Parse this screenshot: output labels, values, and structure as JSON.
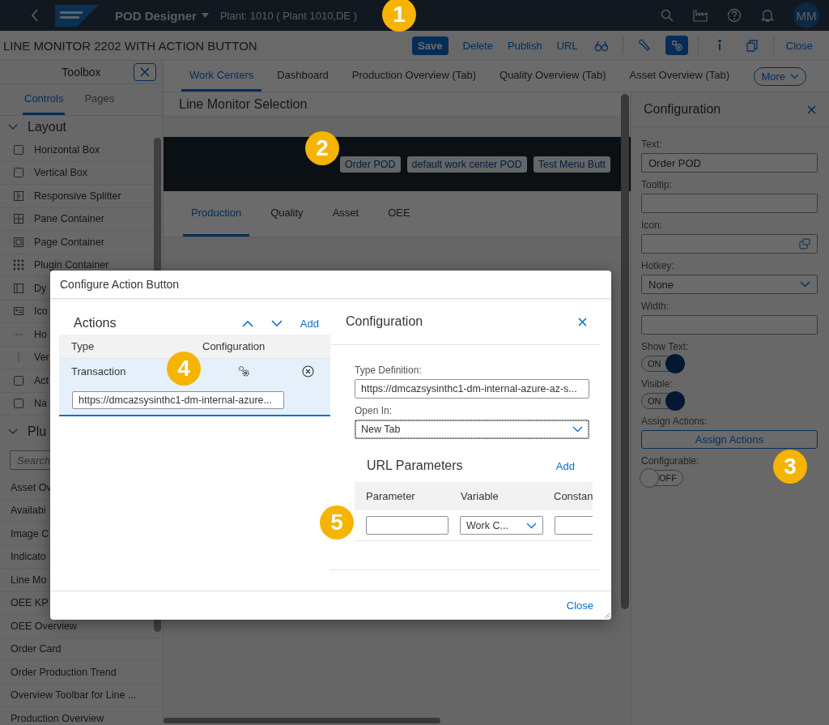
{
  "shell": {
    "title": "POD Designer",
    "plant": "Plant: 1010 ( Plant 1010,DE )",
    "avatar": "MM"
  },
  "toolbar": {
    "title": "LINE MONITOR 2202 WITH ACTION BUTTON",
    "tools": [
      {
        "kind": "emphasized",
        "label": "Save"
      },
      {
        "kind": "text",
        "label": "Delete"
      },
      {
        "kind": "text",
        "label": "Publish"
      },
      {
        "kind": "text",
        "label": "URL"
      },
      {
        "kind": "glasses",
        "pressed": false
      },
      {
        "kind": "separator"
      },
      {
        "kind": "wrench",
        "pressed": false
      },
      {
        "kind": "gears",
        "pressed": true
      },
      {
        "kind": "separator"
      },
      {
        "kind": "info",
        "pressed": false
      },
      {
        "kind": "copy",
        "pressed": false
      },
      {
        "kind": "separator"
      },
      {
        "kind": "text",
        "label": "Close"
      }
    ]
  },
  "toolbox": {
    "title": "Toolbox",
    "tabs": [
      {
        "label": "Controls",
        "selected": true
      },
      {
        "label": "Pages",
        "selected": false
      }
    ],
    "groups": [
      {
        "title": "Layout",
        "expanded": true,
        "items": [
          {
            "kind": "box",
            "label": "Horizontal Box"
          },
          {
            "kind": "box",
            "label": "Vertical Box"
          },
          {
            "kind": "splitter",
            "label": "Responsive Splitter"
          },
          {
            "kind": "pane",
            "label": "Pane Container"
          },
          {
            "kind": "page",
            "label": "Page Container"
          },
          {
            "kind": "plugin",
            "label": "Plugin Container"
          },
          {
            "kind": "dynamic",
            "label": "Dy"
          },
          {
            "kind": "iconitem",
            "label": "Ico"
          },
          {
            "kind": "hline",
            "label": "Ho"
          },
          {
            "kind": "vline",
            "label": "Ver"
          },
          {
            "kind": "checkbox",
            "label": "Act"
          },
          {
            "kind": "checkbox",
            "label": "Na"
          }
        ]
      },
      {
        "title": "Plu",
        "expanded": true,
        "search_placeholder": "Search",
        "items": [
          {
            "label": "Asset Ov"
          },
          {
            "label": "Availabi"
          },
          {
            "label": "Image C"
          },
          {
            "label": "Indicato"
          },
          {
            "label": "Line Mo"
          },
          {
            "label": "OEE KP"
          },
          {
            "label": "OEE Overview"
          },
          {
            "label": "Order Card"
          },
          {
            "label": "Order Production Trend"
          },
          {
            "label": "Overview Toolbar for Line ..."
          },
          {
            "label": "Production Overview"
          }
        ]
      }
    ]
  },
  "page_tabs": {
    "tabs": [
      {
        "label": "Work Centers",
        "selected": true
      },
      {
        "label": "Dashboard",
        "selected": false
      },
      {
        "label": "Production Overview (Tab)",
        "selected": false
      },
      {
        "label": "Quality Overview (Tab)",
        "selected": false
      },
      {
        "label": "Asset Overview (Tab)",
        "selected": false
      }
    ],
    "more": "More"
  },
  "canvas": {
    "title": "Line Monitor Selection",
    "banner_buttons": [
      "Order POD",
      "default work center POD",
      "Test Menu Butt"
    ],
    "tabs": [
      {
        "label": "Production",
        "selected": true
      },
      {
        "label": "Quality",
        "selected": false
      },
      {
        "label": "Asset",
        "selected": false
      },
      {
        "label": "OEE",
        "selected": false
      }
    ]
  },
  "config_panel": {
    "title": "Configuration",
    "fields": [
      {
        "kind": "input",
        "label": "Text:",
        "value": "Order POD"
      },
      {
        "kind": "input",
        "label": "Tooltip:"
      },
      {
        "kind": "icon_input",
        "label": "Icon:"
      },
      {
        "kind": "select",
        "label": "Hotkey:",
        "value": "None"
      },
      {
        "kind": "input",
        "label": "Width:"
      },
      {
        "kind": "switch",
        "label": "Show Text:",
        "on": true,
        "text": "ON"
      },
      {
        "kind": "switch",
        "label": "Visible:",
        "on": true,
        "text": "ON"
      },
      {
        "kind": "button",
        "label": "Assign Actions:",
        "button": "Assign Actions"
      },
      {
        "kind": "switch",
        "label": "Configurable:",
        "on": false,
        "text": "OFF"
      }
    ]
  },
  "dialog": {
    "title": "Configure Action Button",
    "actions": {
      "title": "Actions",
      "add": "Add",
      "columns": [
        "Type",
        "Configuration"
      ],
      "rows": [
        {
          "type": "Transaction",
          "selected": true,
          "url": "https://dmcazsysinthc1-dm-internal-azure..."
        }
      ]
    },
    "configuration": {
      "title": "Configuration",
      "type_definition_label": "Type Definition:",
      "type_definition": "https://dmcazsysinthc1-dm-internal-azure-az-s...",
      "open_in_label": "Open In:",
      "open_in": "New Tab",
      "url_parameters": {
        "title": "URL Parameters",
        "add": "Add",
        "columns": [
          "Parameter",
          "Variable",
          "Constan"
        ],
        "rows": [
          {
            "variable": "Work C..."
          }
        ]
      }
    },
    "close": "Close"
  },
  "markers": [
    "1",
    "2",
    "3",
    "4",
    "5"
  ]
}
